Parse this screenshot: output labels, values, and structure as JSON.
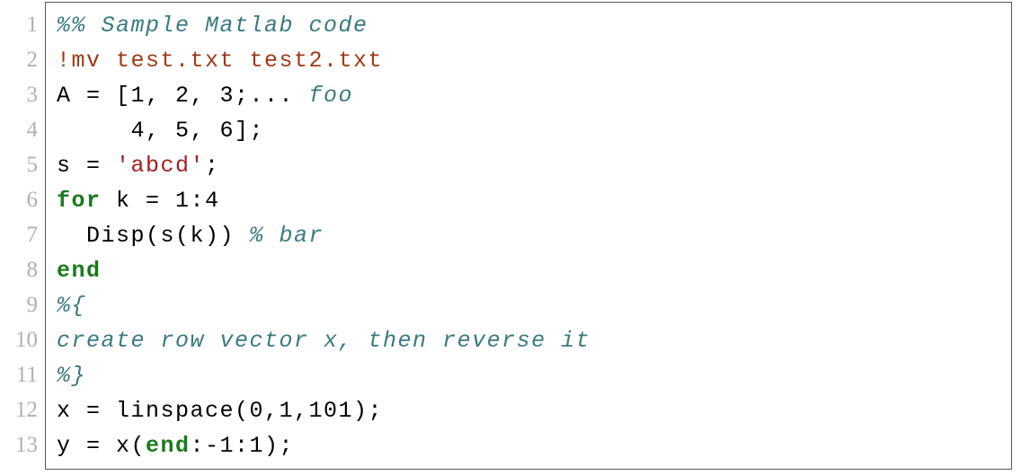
{
  "listing": {
    "line_numbers": [
      "1",
      "2",
      "3",
      "4",
      "5",
      "6",
      "7",
      "8",
      "9",
      "10",
      "11",
      "12",
      "13"
    ],
    "lines": [
      {
        "tokens": [
          {
            "t": "%% Sample Matlab code",
            "cls": "comment"
          }
        ]
      },
      {
        "tokens": [
          {
            "t": "!mv test.txt test2.txt",
            "cls": "syscmd"
          }
        ]
      },
      {
        "tokens": [
          {
            "t": "A = [1, 2, 3;... ",
            "cls": "default"
          },
          {
            "t": "foo",
            "cls": "comment"
          }
        ]
      },
      {
        "tokens": [
          {
            "t": "     4, 5, 6];",
            "cls": "default"
          }
        ]
      },
      {
        "tokens": [
          {
            "t": "s = ",
            "cls": "default"
          },
          {
            "t": "'abcd'",
            "cls": "string"
          },
          {
            "t": ";",
            "cls": "default"
          }
        ]
      },
      {
        "tokens": [
          {
            "t": "for",
            "cls": "keyword"
          },
          {
            "t": " k = 1:4",
            "cls": "default"
          }
        ]
      },
      {
        "tokens": [
          {
            "t": "  Disp(s(k)) ",
            "cls": "default"
          },
          {
            "t": "% bar",
            "cls": "comment"
          }
        ]
      },
      {
        "tokens": [
          {
            "t": "end",
            "cls": "keyword"
          }
        ]
      },
      {
        "tokens": [
          {
            "t": "%{",
            "cls": "comment"
          }
        ]
      },
      {
        "tokens": [
          {
            "t": "create row vector x, then reverse it",
            "cls": "comment"
          }
        ]
      },
      {
        "tokens": [
          {
            "t": "%}",
            "cls": "comment"
          }
        ]
      },
      {
        "tokens": [
          {
            "t": "x = linspace(0,1,101);",
            "cls": "default"
          }
        ]
      },
      {
        "tokens": [
          {
            "t": "y = x(",
            "cls": "default"
          },
          {
            "t": "end",
            "cls": "keyword"
          },
          {
            "t": ":-1:1);",
            "cls": "default"
          }
        ]
      }
    ]
  },
  "colors": {
    "comment": "#3b7a80",
    "keyword": "#1a7a1a",
    "syscmd": "#9f3a16",
    "string": "#a02020",
    "default": "#000000",
    "border": "#555555",
    "linenum": "#b0b0b0"
  }
}
